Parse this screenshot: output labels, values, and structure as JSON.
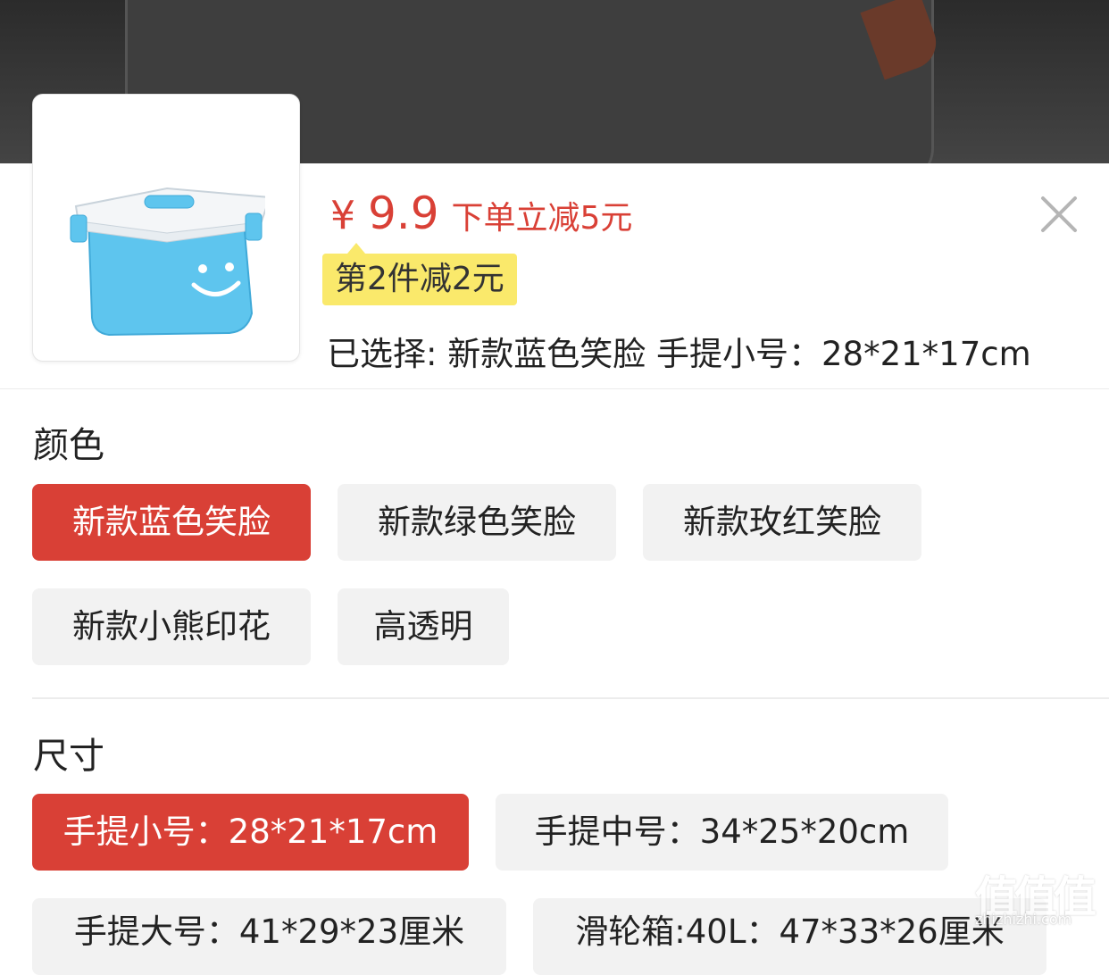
{
  "product": {
    "currency": "¥",
    "price": "9.9",
    "promo_text": "下单立减5元",
    "coupon_text": "第2件减2元",
    "selected_label": "已选择: 新款蓝色笑脸 手提小号：28*21*17cm",
    "image_icon": "storage-box-image"
  },
  "colors": {
    "accent": "#d94036",
    "coupon_bg": "#fae96b",
    "chip_bg": "#f2f2f2"
  },
  "color_section": {
    "title": "颜色",
    "options": [
      {
        "label": "新款蓝色笑脸",
        "selected": true
      },
      {
        "label": "新款绿色笑脸",
        "selected": false
      },
      {
        "label": "新款玫红笑脸",
        "selected": false
      },
      {
        "label": "新款小熊印花",
        "selected": false
      },
      {
        "label": "高透明",
        "selected": false
      }
    ]
  },
  "size_section": {
    "title": "尺寸",
    "options": [
      {
        "label": "手提小号：28*21*17cm",
        "selected": true
      },
      {
        "label": "手提中号：34*25*20cm",
        "selected": false
      },
      {
        "label": "手提大号：41*29*23厘米",
        "selected": false
      },
      {
        "label": "滑轮箱:40L：47*33*26厘米",
        "selected": false
      }
    ]
  },
  "watermark": {
    "text": "值值值",
    "sub": "zhizhizhi.com"
  }
}
